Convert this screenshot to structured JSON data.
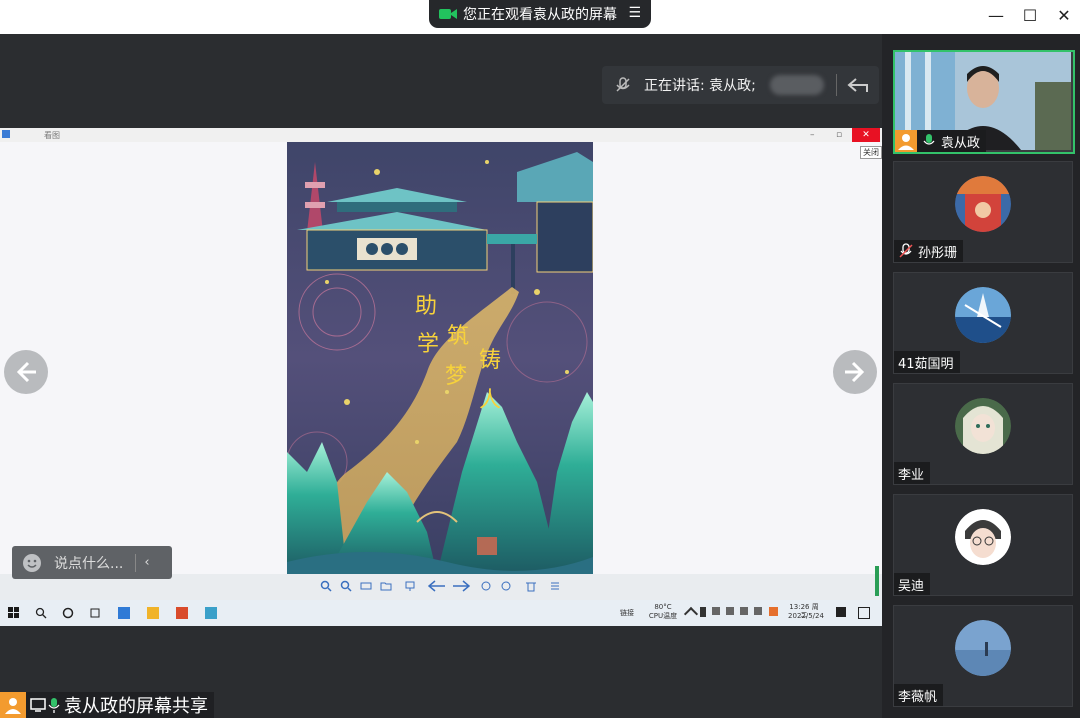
{
  "window": {
    "share_banner": "您正在观看袁从政的屏幕",
    "menu_icon": "list-icon",
    "controls": [
      "—",
      "☐",
      "✕"
    ]
  },
  "speaker_bar": {
    "text": "正在讲话: 袁从政;",
    "icons": [
      "mic-off-icon",
      "back-arrow-icon"
    ]
  },
  "shared_screen": {
    "viewer": {
      "title": "看图",
      "close_tip": "关闭"
    },
    "poster_text": [
      "助",
      "学",
      "筑",
      "梦",
      "铸",
      "人"
    ],
    "taskbar": {
      "status_label": "链接",
      "cpu_temp": "80°C",
      "cpu_label": "CPU温度",
      "time": "13:26 周二",
      "date": "2022/5/24"
    }
  },
  "chat": {
    "placeholder": "说点什么...",
    "collapse_icon": "chevron-left-icon"
  },
  "bottom": {
    "share_label": "袁从政的屏幕共享"
  },
  "participants": [
    {
      "name": "袁从政",
      "mic": "on",
      "video": true
    },
    {
      "name": "孙彤珊",
      "mic": "off"
    },
    {
      "name": "41茹国明",
      "mic": "none"
    },
    {
      "name": "李业",
      "mic": "none"
    },
    {
      "name": "吴迪",
      "mic": "none"
    },
    {
      "name": "李薇帆",
      "mic": "none"
    }
  ],
  "colors": {
    "accent_green": "#33c26a",
    "close_red": "#e81123",
    "poster_gold": "#f7d23b"
  }
}
